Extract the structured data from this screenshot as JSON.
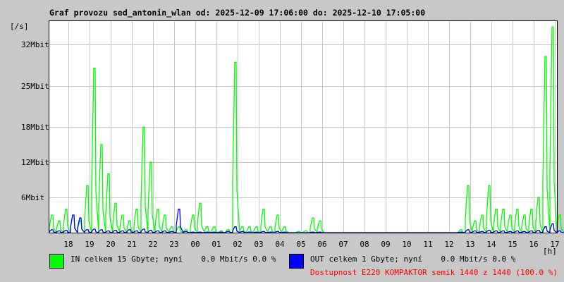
{
  "title": "Graf provozu sed_antonin_wlan od: 2025-12-09 17:06:00 do: 2025-12-10 17:05:00",
  "legend": {
    "in_label": "IN celkem 15 Gbyte; nyní    0.0 Mbit/s 0.0 %",
    "out_label": "OUT celkem 1 Gbyte; nyní    0.0 Mbit/s 0.0 %",
    "availability": "Dostupnost E220 KOMPAKTOR semik 1440 z 1440 (100.0 %)",
    "in_color": "#00ff00",
    "out_color": "#0000ff"
  },
  "chart_data": {
    "type": "line",
    "title": "Graf provozu sed_antonin_wlan od: 2025-12-09 17:06:00 do: 2025-12-10 17:05:00",
    "ylabel": "[/s]",
    "xlabel": "[h]",
    "y_unit": "Mbit",
    "ylim": [
      0,
      36
    ],
    "yticks": [
      {
        "v": 6,
        "label": "6Mbit"
      },
      {
        "v": 12,
        "label": "12Mbit"
      },
      {
        "v": 18,
        "label": "18Mbit"
      },
      {
        "v": 25,
        "label": "25Mbit"
      },
      {
        "v": 32,
        "label": "32Mbit"
      }
    ],
    "x_start_minute": 6,
    "x_span_minutes": 1440,
    "x_sample_minutes": 20,
    "xticks": [
      "18",
      "19",
      "20",
      "21",
      "22",
      "23",
      "00",
      "01",
      "02",
      "03",
      "04",
      "05",
      "06",
      "07",
      "08",
      "09",
      "10",
      "11",
      "12",
      "13",
      "14",
      "15",
      "16",
      "17"
    ],
    "grid": true,
    "series": [
      {
        "name": "IN",
        "color": "#00ff00",
        "values": [
          3,
          2,
          4,
          3,
          2,
          8,
          28,
          15,
          10,
          5,
          3,
          2,
          4,
          18,
          12,
          4,
          3,
          1,
          1,
          0.5,
          3,
          5,
          1,
          1,
          0.3,
          0.5,
          29,
          1,
          1,
          1,
          4,
          1,
          3,
          1,
          0,
          0.2,
          0.3,
          2.5,
          2,
          0,
          0,
          0,
          0,
          0,
          0,
          0,
          0,
          0,
          0,
          0,
          0,
          0,
          0,
          0,
          0,
          0,
          0,
          0,
          0.5,
          8,
          2,
          3,
          8,
          4,
          4,
          3,
          4,
          3,
          4,
          6,
          30,
          35,
          3
        ]
      },
      {
        "name": "OUT",
        "color": "#0000ff",
        "values": [
          0.5,
          0.3,
          0.4,
          3,
          2.5,
          0.5,
          0.6,
          0.5,
          0.3,
          0.4,
          0.3,
          0.5,
          0.3,
          0.6,
          0.4,
          0.3,
          0.3,
          0.2,
          4,
          0.2,
          0.1,
          0.1,
          0.1,
          0.1,
          0.1,
          0.2,
          1,
          0.2,
          0.1,
          0.1,
          0.2,
          0.1,
          0.2,
          0.1,
          0,
          0,
          0,
          0.1,
          0.1,
          0,
          0,
          0,
          0,
          0,
          0,
          0,
          0,
          0,
          0,
          0,
          0,
          0,
          0,
          0,
          0,
          0,
          0,
          0,
          0.1,
          0.5,
          0.3,
          0.2,
          0.4,
          0.3,
          0.3,
          0.2,
          0.3,
          0.2,
          0.3,
          0.4,
          1,
          1.5,
          0.3
        ]
      }
    ]
  }
}
